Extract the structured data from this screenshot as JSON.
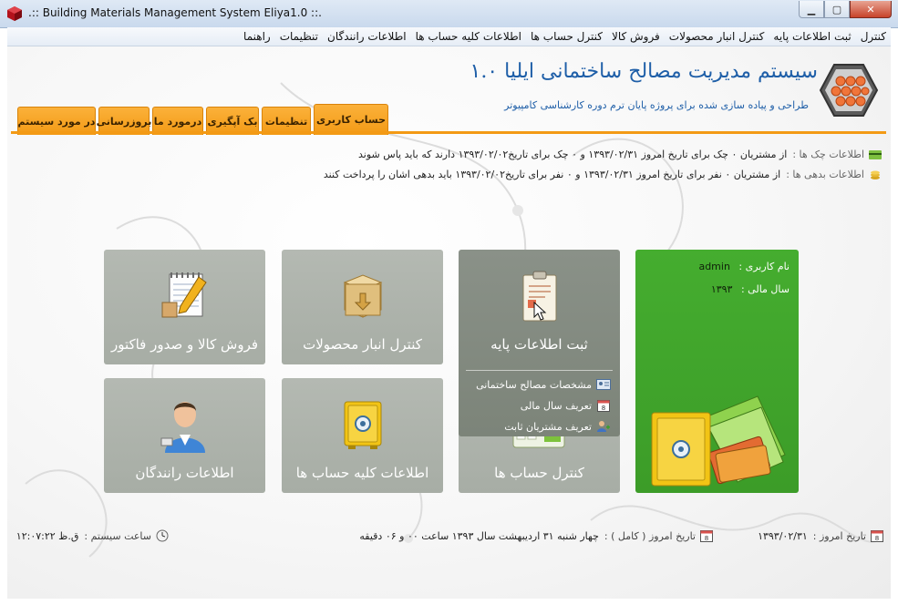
{
  "window": {
    "title": ".:: Building Materials Management System Eliya1.0 ::.",
    "min_label": "▁",
    "max_label": "▢",
    "close_label": "✕"
  },
  "menu": [
    "کنترل",
    "ثبت اطلاعات پایه",
    "کنترل انبار محصولات",
    "فروش کالا",
    "کنترل حساب ها",
    "اطلاعات کلیه حساب ها",
    "اطلاعات رانندگان",
    "تنظیمات",
    "راهنما"
  ],
  "header": {
    "title": "سیستم مدیریت مصالح ساختمانی ایلیا ۱.۰",
    "subtitle": "طراحی و پیاده سازی شده برای پروژه پایان ترم دوره کارشناسی کامپیوتر"
  },
  "tabs": [
    "حساب کاربری",
    "تنظیمات",
    "بک آپگیری",
    "درمورد ما",
    "بروزرسانی",
    "در مورد سیستم"
  ],
  "info": {
    "checks_label": "اطلاعات چک ها :",
    "checks_text": "از مشتریان ۰ چک برای تاریخ امروز ۱۳۹۳/۰۲/۳۱ و ۰ چک برای تاریخ۱۳۹۳/۰۲/۰۲ دارند که باید پاس شوند",
    "debts_label": "اطلاعات بدهی ها :",
    "debts_text": "از مشتریان ۰ نفر برای تاریخ امروز ۱۳۹۳/۰۲/۳۱ و ۰ نفر برای تاریخ۱۳۹۳/۰۲/۰۲ باید بدهی اشان را پرداخت کنند"
  },
  "tiles": {
    "sales": "فروش کالا و صدور فاکتور",
    "warehouse": "کنترل انبار محصولات",
    "base_info": "ثبت اطلاعات پایه",
    "drivers": "اطلاعات رانندگان",
    "all_accounts": "اطلاعات کلیه حساب ها",
    "accounts": "کنترل حساب ها"
  },
  "base_info_menu": [
    "مشخصات مصالح ساختمانی",
    "تعریف سال مالی",
    "تعریف مشتریان ثابت"
  ],
  "user": {
    "username_label": "نام کاربری :",
    "username": "admin",
    "year_label": "سال مالی :",
    "year": "۱۳۹۳"
  },
  "status": {
    "date_label": "تاریخ امروز :",
    "date": "۱۳۹۳/۰۲/۳۱",
    "full_date_label": "تاریخ امروز ( کامل ) :",
    "full_date": "چهار شنبه ۳۱ اردیبهشت سال ۱۳۹۳ ساعت ۰۰ و ۰۶ دقیقه",
    "clock_label": "ساعت سیستم :",
    "clock": "ق.ظ ۱۲:۰۷:۲۲"
  },
  "colors": {
    "accent_orange": "#f39a15",
    "title_blue": "#1f5fa8",
    "user_panel_green": "#45ad2f",
    "tile_gray": "#a7ada5"
  }
}
